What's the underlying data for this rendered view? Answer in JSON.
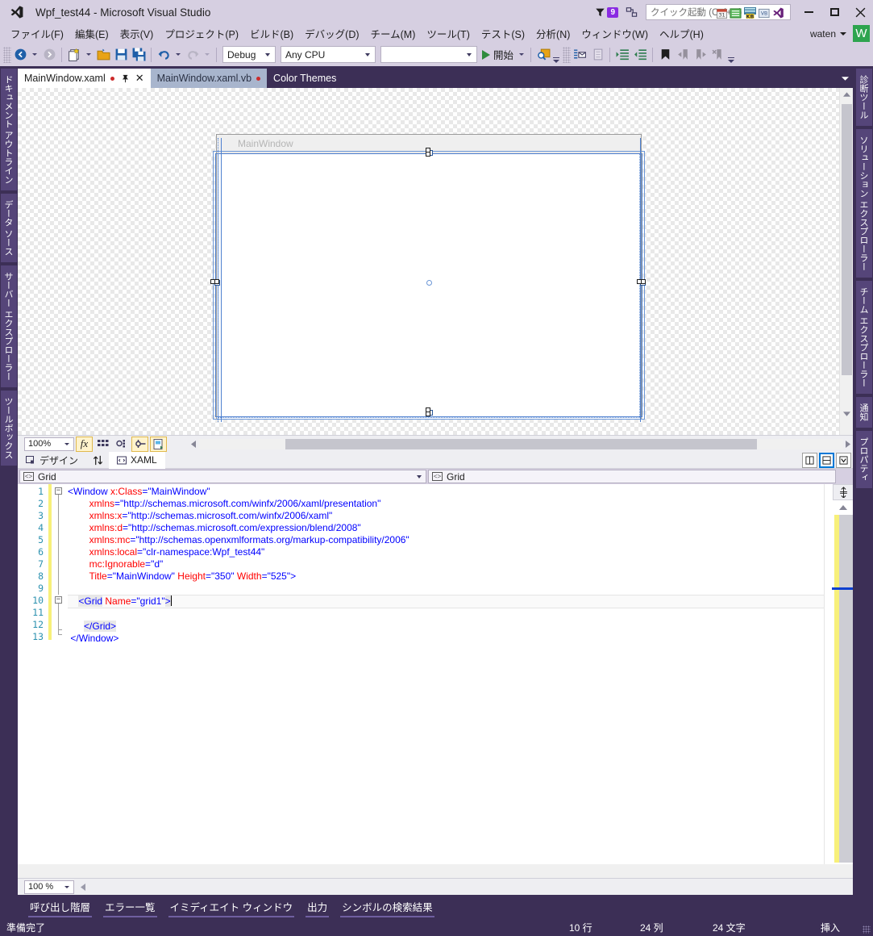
{
  "window": {
    "title": "Wpf_test44 - Microsoft Visual Studio",
    "logo_icon": "visual-studio-logo",
    "minimize_icon": "minimize-icon",
    "maximize_icon": "maximize-icon",
    "close_icon": "close-icon"
  },
  "titlebar": {
    "feedback_icon": "feedback-funnel-icon",
    "notification_count": "9",
    "connect_icon": "connect-icon",
    "quick_launch_placeholder": "クイック起動 (Ctrl+Q)",
    "overlay_icons": [
      "calendar-icon",
      "tree-icon",
      "keyboard-icon",
      "vb-icon",
      "vs-icon"
    ]
  },
  "menubar": {
    "items": [
      {
        "label": "ファイル(F)",
        "accel": "F"
      },
      {
        "label": "編集(E)",
        "accel": "E"
      },
      {
        "label": "表示(V)",
        "accel": "V"
      },
      {
        "label": "プロジェクト(P)",
        "accel": "P"
      },
      {
        "label": "ビルド(B)",
        "accel": "B"
      },
      {
        "label": "デバッグ(D)",
        "accel": "D"
      },
      {
        "label": "チーム(M)",
        "accel": "M"
      },
      {
        "label": "ツール(T)",
        "accel": "T"
      },
      {
        "label": "テスト(S)",
        "accel": "S"
      },
      {
        "label": "分析(N)",
        "accel": "N"
      },
      {
        "label": "ウィンドウ(W)",
        "accel": "W"
      },
      {
        "label": "ヘルプ(H)",
        "accel": "H"
      }
    ],
    "user_name": "waten",
    "avatar_initial": "W"
  },
  "toolbar": {
    "navigate_back_icon": "navigate-back-icon",
    "navigate_forward_icon": "navigate-forward-icon",
    "new_project_icon": "new-project-icon",
    "open_file_icon": "open-file-icon",
    "save_icon": "save-icon",
    "save_all_icon": "save-all-icon",
    "undo_icon": "undo-icon",
    "redo_icon": "redo-icon",
    "configuration": "Debug",
    "platform": "Any CPU",
    "startup_project": "",
    "start_label": "開始",
    "start_icon": "play-icon",
    "find_icon": "find-in-files-icon",
    "comment_icon": "comment-icon",
    "uncomment_icon": "uncomment-icon",
    "indent_icon": "increase-indent-icon",
    "outdent_icon": "decrease-indent-icon",
    "bookmark_icon": "bookmark-icon",
    "prev_bookmark_icon": "previous-bookmark-icon",
    "next_bookmark_icon": "next-bookmark-icon",
    "clear_bookmark_icon": "clear-bookmarks-icon",
    "overflow_icon": "toolbar-overflow-icon"
  },
  "left_dock": {
    "items": [
      {
        "label": "ドキュメント アウトライン",
        "icon": "document-outline-icon"
      },
      {
        "label": "データ ソース",
        "icon": "data-sources-icon"
      },
      {
        "label": "サーバー エクスプローラー",
        "icon": "server-explorer-icon"
      },
      {
        "label": "ツールボックス",
        "icon": "toolbox-icon"
      }
    ]
  },
  "right_dock": {
    "items": [
      {
        "label": "診断ツール",
        "icon": "diagnostic-tools-icon"
      },
      {
        "label": "ソリューション エクスプローラー",
        "icon": "solution-explorer-icon"
      },
      {
        "label": "チーム エクスプローラー",
        "icon": "team-explorer-icon"
      },
      {
        "label": "通知",
        "icon": "notifications-icon"
      },
      {
        "label": "プロパティ",
        "icon": "properties-icon"
      }
    ]
  },
  "document_tabs": [
    {
      "label": "MainWindow.xaml",
      "state": "active",
      "dirty": true,
      "pinnable": true,
      "closable": true
    },
    {
      "label": "MainWindow.xaml.vb",
      "state": "inactive",
      "dirty": true
    },
    {
      "label": "Color Themes",
      "state": "plain",
      "dirty": false
    }
  ],
  "designer": {
    "window_caption": "MainWindow",
    "zoom": "100%",
    "fx_button": "effects-button",
    "grid_button": "show-grid-button",
    "snap_button": "snap-to-gridlines-button",
    "align_button": "snap-to-snaplines-button",
    "refresh_button": "refresh-designer-button",
    "selected_element": "grid1"
  },
  "view_switch": {
    "design_tab": "デザイン",
    "design_icon": "design-view-icon",
    "swap_icon": "swap-panes-icon",
    "xaml_tab": "XAML",
    "xaml_icon": "xaml-view-icon",
    "split_vertical_icon": "split-vertical-icon",
    "split_horizontal_icon": "split-horizontal-icon",
    "collapse_pane_icon": "collapse-pane-icon"
  },
  "code_nav": {
    "left_combo": "Grid",
    "right_combo": "Grid",
    "combo_icon": "xaml-element-icon"
  },
  "editor": {
    "zoom": "100 %",
    "line_numbers": [
      "1",
      "2",
      "3",
      "4",
      "5",
      "6",
      "7",
      "8",
      "9",
      "10",
      "11",
      "12",
      "13"
    ],
    "lines": [
      {
        "n": 1,
        "indent": 0,
        "tokens": [
          {
            "t": "punct",
            "s": "<"
          },
          {
            "t": "tag",
            "s": "Window"
          },
          {
            "t": "plain",
            "s": " "
          },
          {
            "t": "attr",
            "s": "x:Class"
          },
          {
            "t": "punct",
            "s": "="
          },
          {
            "t": "val",
            "s": "\"MainWindow\""
          }
        ]
      },
      {
        "n": 2,
        "indent": 8,
        "tokens": [
          {
            "t": "attr",
            "s": "xmlns"
          },
          {
            "t": "punct",
            "s": "="
          },
          {
            "t": "val",
            "s": "\"http://schemas.microsoft.com/winfx/2006/xaml/presentation\""
          }
        ]
      },
      {
        "n": 3,
        "indent": 8,
        "tokens": [
          {
            "t": "attr",
            "s": "xmlns:x"
          },
          {
            "t": "punct",
            "s": "="
          },
          {
            "t": "val",
            "s": "\"http://schemas.microsoft.com/winfx/2006/xaml\""
          }
        ]
      },
      {
        "n": 4,
        "indent": 8,
        "tokens": [
          {
            "t": "attr",
            "s": "xmlns:d"
          },
          {
            "t": "punct",
            "s": "="
          },
          {
            "t": "val",
            "s": "\"http://schemas.microsoft.com/expression/blend/2008\""
          }
        ]
      },
      {
        "n": 5,
        "indent": 8,
        "tokens": [
          {
            "t": "attr",
            "s": "xmlns:mc"
          },
          {
            "t": "punct",
            "s": "="
          },
          {
            "t": "val",
            "s": "\"http://schemas.openxmlformats.org/markup-compatibility/2006\""
          }
        ]
      },
      {
        "n": 6,
        "indent": 8,
        "tokens": [
          {
            "t": "attr",
            "s": "xmlns:local"
          },
          {
            "t": "punct",
            "s": "="
          },
          {
            "t": "val",
            "s": "\"clr-namespace:Wpf_test44\""
          }
        ]
      },
      {
        "n": 7,
        "indent": 8,
        "tokens": [
          {
            "t": "attr",
            "s": "mc:Ignorable"
          },
          {
            "t": "punct",
            "s": "="
          },
          {
            "t": "val",
            "s": "\"d\""
          }
        ]
      },
      {
        "n": 8,
        "indent": 8,
        "tokens": [
          {
            "t": "attr",
            "s": "Title"
          },
          {
            "t": "punct",
            "s": "="
          },
          {
            "t": "val",
            "s": "\"MainWindow\""
          },
          {
            "t": "plain",
            "s": " "
          },
          {
            "t": "attr",
            "s": "Height"
          },
          {
            "t": "punct",
            "s": "="
          },
          {
            "t": "val",
            "s": "\"350\""
          },
          {
            "t": "plain",
            "s": " "
          },
          {
            "t": "attr",
            "s": "Width"
          },
          {
            "t": "punct",
            "s": "="
          },
          {
            "t": "val",
            "s": "\"525\""
          },
          {
            "t": "punct",
            "s": ">"
          }
        ]
      },
      {
        "n": 9,
        "indent": 0,
        "tokens": []
      },
      {
        "n": 10,
        "indent": 4,
        "highlight": true,
        "tokens": [
          {
            "t": "punct-hl",
            "s": "<"
          },
          {
            "t": "tag-hl",
            "s": "Grid"
          },
          {
            "t": "plain",
            "s": " "
          },
          {
            "t": "attr",
            "s": "Name"
          },
          {
            "t": "punct",
            "s": "="
          },
          {
            "t": "val",
            "s": "\"grid1\""
          },
          {
            "t": "punct-hl",
            "s": ">"
          }
        ],
        "caret": true
      },
      {
        "n": 11,
        "indent": 0,
        "tokens": []
      },
      {
        "n": 12,
        "indent": 6,
        "tokens": [
          {
            "t": "punct-hl",
            "s": "</"
          },
          {
            "t": "tag-hl",
            "s": "Grid"
          },
          {
            "t": "punct-hl",
            "s": ">"
          }
        ]
      },
      {
        "n": 13,
        "indent": 1,
        "tokens": [
          {
            "t": "punct",
            "s": "</"
          },
          {
            "t": "tag",
            "s": "Window"
          },
          {
            "t": "punct",
            "s": ">"
          }
        ]
      }
    ]
  },
  "bottom_tabs": [
    {
      "label": "呼び出し階層"
    },
    {
      "label": "エラー一覧"
    },
    {
      "label": "イミディエイト ウィンドウ"
    },
    {
      "label": "出力"
    },
    {
      "label": "シンボルの検索結果"
    }
  ],
  "statusbar": {
    "status": "準備完了",
    "line": "10 行",
    "column": "24 列",
    "character": "24 文字",
    "insert_mode": "挿入"
  },
  "colors": {
    "chrome": "#3c2f56",
    "toolbar": "#d6cfe1",
    "accent": "#8a2be2",
    "avatar": "#2ea44f",
    "tag": "#0000ff",
    "attribute": "#ff0000",
    "line_number": "#2b91af",
    "selection_blue": "#4f81d0",
    "dirty_dot": "#cc2b2b"
  }
}
